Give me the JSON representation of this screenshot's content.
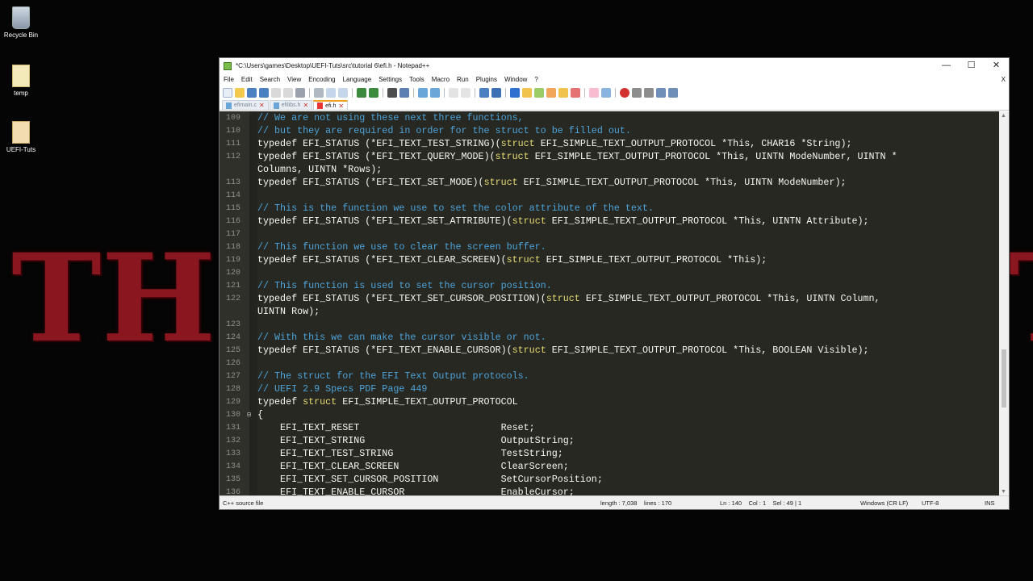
{
  "desktop": {
    "icons": [
      {
        "label": "Recycle Bin"
      },
      {
        "label": "temp"
      },
      {
        "label": "UEFI-Tuts"
      }
    ],
    "wallpaper_text_left": "TH",
    "wallpaper_text_right": "T"
  },
  "window": {
    "title": "*C:\\Users\\games\\Desktop\\UEFI-Tuts\\src\\tutorial 6\\efi.h - Notepad++",
    "controls": {
      "minimize": "—",
      "maximize": "☐",
      "close": "✕"
    }
  },
  "menu": {
    "items": [
      "File",
      "Edit",
      "Search",
      "View",
      "Encoding",
      "Language",
      "Settings",
      "Tools",
      "Macro",
      "Run",
      "Plugins",
      "Window",
      "?"
    ],
    "close_label": "X"
  },
  "tabs": [
    {
      "label": "efimain.c",
      "close": "✕"
    },
    {
      "label": "efilibs.h",
      "close": "✕"
    },
    {
      "label": "efi.h",
      "close": "✕"
    }
  ],
  "editor": {
    "lines": [
      {
        "n": "109",
        "parts": [
          [
            "cm",
            "// We are not using these next three functions,"
          ]
        ]
      },
      {
        "n": "110",
        "parts": [
          [
            "cm",
            "// but they are required in order for the struct to be filled out."
          ]
        ]
      },
      {
        "n": "111",
        "parts": [
          [
            "ty",
            "typedef EFI_STATUS "
          ],
          [
            "pn",
            "("
          ],
          [
            "fn",
            "*EFI_TEXT_TEST_STRING"
          ],
          [
            "pn",
            ")("
          ],
          [
            "kw",
            "struct "
          ],
          [
            "ar",
            "EFI_SIMPLE_TEXT_OUTPUT_PROTOCOL *This, CHAR16 *String"
          ],
          [
            "pn",
            ");"
          ]
        ]
      },
      {
        "n": "112",
        "parts": [
          [
            "ty",
            "typedef EFI_STATUS "
          ],
          [
            "pn",
            "("
          ],
          [
            "fn",
            "*EFI_TEXT_QUERY_MODE"
          ],
          [
            "pn",
            ")("
          ],
          [
            "kw",
            "struct "
          ],
          [
            "ar",
            "EFI_SIMPLE_TEXT_OUTPUT_PROTOCOL *This, UINTN ModeNumber, UINTN *"
          ]
        ]
      },
      {
        "n": "",
        "parts": [
          [
            "ar",
            "Columns, UINTN *Rows"
          ],
          [
            "pn",
            ");"
          ]
        ]
      },
      {
        "n": "113",
        "parts": [
          [
            "ty",
            "typedef EFI_STATUS "
          ],
          [
            "pn",
            "("
          ],
          [
            "fn",
            "*EFI_TEXT_SET_MODE"
          ],
          [
            "pn",
            ")("
          ],
          [
            "kw",
            "struct "
          ],
          [
            "ar",
            "EFI_SIMPLE_TEXT_OUTPUT_PROTOCOL *This, UINTN ModeNumber"
          ],
          [
            "pn",
            ");"
          ]
        ]
      },
      {
        "n": "114",
        "parts": []
      },
      {
        "n": "115",
        "parts": [
          [
            "cm",
            "// This is the function we use to set the color attribute of the text."
          ]
        ]
      },
      {
        "n": "116",
        "parts": [
          [
            "ty",
            "typedef EFI_STATUS "
          ],
          [
            "pn",
            "("
          ],
          [
            "fn",
            "*EFI_TEXT_SET_ATTRIBUTE"
          ],
          [
            "pn",
            ")("
          ],
          [
            "kw",
            "struct "
          ],
          [
            "ar",
            "EFI_SIMPLE_TEXT_OUTPUT_PROTOCOL *This, UINTN Attribute"
          ],
          [
            "pn",
            ");"
          ]
        ]
      },
      {
        "n": "117",
        "parts": []
      },
      {
        "n": "118",
        "parts": [
          [
            "cm",
            "// This function we use to clear the screen buffer."
          ]
        ]
      },
      {
        "n": "119",
        "parts": [
          [
            "ty",
            "typedef EFI_STATUS "
          ],
          [
            "pn",
            "("
          ],
          [
            "fn",
            "*EFI_TEXT_CLEAR_SCREEN"
          ],
          [
            "pn",
            ")("
          ],
          [
            "kw",
            "struct "
          ],
          [
            "ar",
            "EFI_SIMPLE_TEXT_OUTPUT_PROTOCOL *This"
          ],
          [
            "pn",
            ");"
          ]
        ]
      },
      {
        "n": "120",
        "parts": []
      },
      {
        "n": "121",
        "parts": [
          [
            "cm",
            "// This function is used to set the cursor position."
          ]
        ]
      },
      {
        "n": "122",
        "parts": [
          [
            "ty",
            "typedef EFI_STATUS "
          ],
          [
            "pn",
            "("
          ],
          [
            "fn",
            "*EFI_TEXT_SET_CURSOR_POSITION"
          ],
          [
            "pn",
            ")("
          ],
          [
            "kw",
            "struct "
          ],
          [
            "ar",
            "EFI_SIMPLE_TEXT_OUTPUT_PROTOCOL *This, UINTN Column,"
          ]
        ]
      },
      {
        "n": "",
        "parts": [
          [
            "ar",
            "UINTN Row"
          ],
          [
            "pn",
            ");"
          ]
        ]
      },
      {
        "n": "123",
        "parts": []
      },
      {
        "n": "124",
        "parts": [
          [
            "cm",
            "// With this we can make the cursor visible or not."
          ]
        ]
      },
      {
        "n": "125",
        "parts": [
          [
            "ty",
            "typedef EFI_STATUS "
          ],
          [
            "pn",
            "("
          ],
          [
            "fn",
            "*EFI_TEXT_ENABLE_CURSOR"
          ],
          [
            "pn",
            ")("
          ],
          [
            "kw",
            "struct "
          ],
          [
            "ar",
            "EFI_SIMPLE_TEXT_OUTPUT_PROTOCOL *This, BOOLEAN Visible"
          ],
          [
            "pn",
            ");"
          ]
        ]
      },
      {
        "n": "126",
        "parts": []
      },
      {
        "n": "127",
        "parts": [
          [
            "cm",
            "// The struct for the EFI Text Output protocols."
          ]
        ]
      },
      {
        "n": "128",
        "parts": [
          [
            "cm",
            "// UEFI 2.9 Specs PDF Page 449"
          ]
        ]
      },
      {
        "n": "129",
        "parts": [
          [
            "ty",
            "typedef "
          ],
          [
            "kw",
            "struct "
          ],
          [
            "ar",
            "EFI_SIMPLE_TEXT_OUTPUT_PROTOCOL"
          ]
        ]
      },
      {
        "n": "130",
        "fold": "⊟",
        "parts": [
          [
            "pn",
            "{"
          ]
        ]
      },
      {
        "n": "131",
        "parts": [
          [
            "ar",
            "    EFI_TEXT_RESET                         Reset;"
          ]
        ]
      },
      {
        "n": "132",
        "parts": [
          [
            "ar",
            "    EFI_TEXT_STRING                        OutputString;"
          ]
        ]
      },
      {
        "n": "133",
        "parts": [
          [
            "ar",
            "    EFI_TEXT_TEST_STRING                   TestString;"
          ]
        ]
      },
      {
        "n": "134",
        "parts": [
          [
            "ar",
            "    EFI_TEXT_CLEAR_SCREEN                  ClearScreen;"
          ]
        ]
      },
      {
        "n": "135",
        "parts": [
          [
            "ar",
            "    EFI_TEXT_SET_CURSOR_POSITION           SetCursorPosition;"
          ]
        ]
      },
      {
        "n": "136",
        "parts": [
          [
            "ar",
            "    EFI_TEXT_ENABLE_CURSOR                 EnableCursor;"
          ]
        ]
      }
    ]
  },
  "statusbar": {
    "filetype": "C++ source file",
    "length": "length : 7,038",
    "lines": "lines : 170",
    "position": "Ln : 140    Col : 1    Sel : 49 | 1",
    "eol": "Windows (CR LF)",
    "encoding": "UTF-8",
    "mode": "INS"
  },
  "colors": {
    "editor_bg": "#272822",
    "comment": "#4ea3d9",
    "keyword": "#e6db74",
    "tab_accent": "#f0a21f"
  }
}
